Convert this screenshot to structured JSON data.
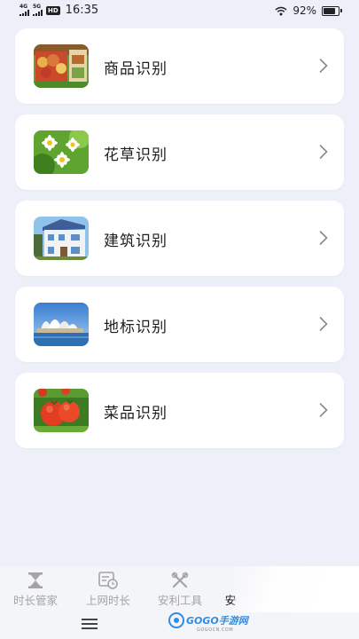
{
  "status_bar": {
    "sim1_network": "4G",
    "sim2_network": "5G",
    "hd_label": "HD",
    "time": "16:35",
    "battery_text": "92%",
    "battery_level": 0.92
  },
  "items": [
    {
      "label": "商品识别",
      "icon": "grocery-photo-icon"
    },
    {
      "label": "花草识别",
      "icon": "flower-photo-icon"
    },
    {
      "label": "建筑识别",
      "icon": "building-photo-icon"
    },
    {
      "label": "地标识别",
      "icon": "landmark-photo-icon"
    },
    {
      "label": "菜品识别",
      "icon": "tomato-photo-icon"
    }
  ],
  "bottom_nav": {
    "items": [
      {
        "label": "时长管家",
        "icon": "hourglass-icon"
      },
      {
        "label": "上网时长",
        "icon": "web-time-icon"
      },
      {
        "label": "安利工具",
        "icon": "tools-icon"
      },
      {
        "label": "安",
        "icon": ""
      }
    ]
  },
  "watermark": {
    "text": "GOGO手游网",
    "sub": "GOGOCN.COM"
  },
  "colors": {
    "background": "#edf0f9",
    "card": "#ffffff",
    "nav_inactive": "#a4a4a4",
    "watermark_blue": "#2f8de4"
  }
}
